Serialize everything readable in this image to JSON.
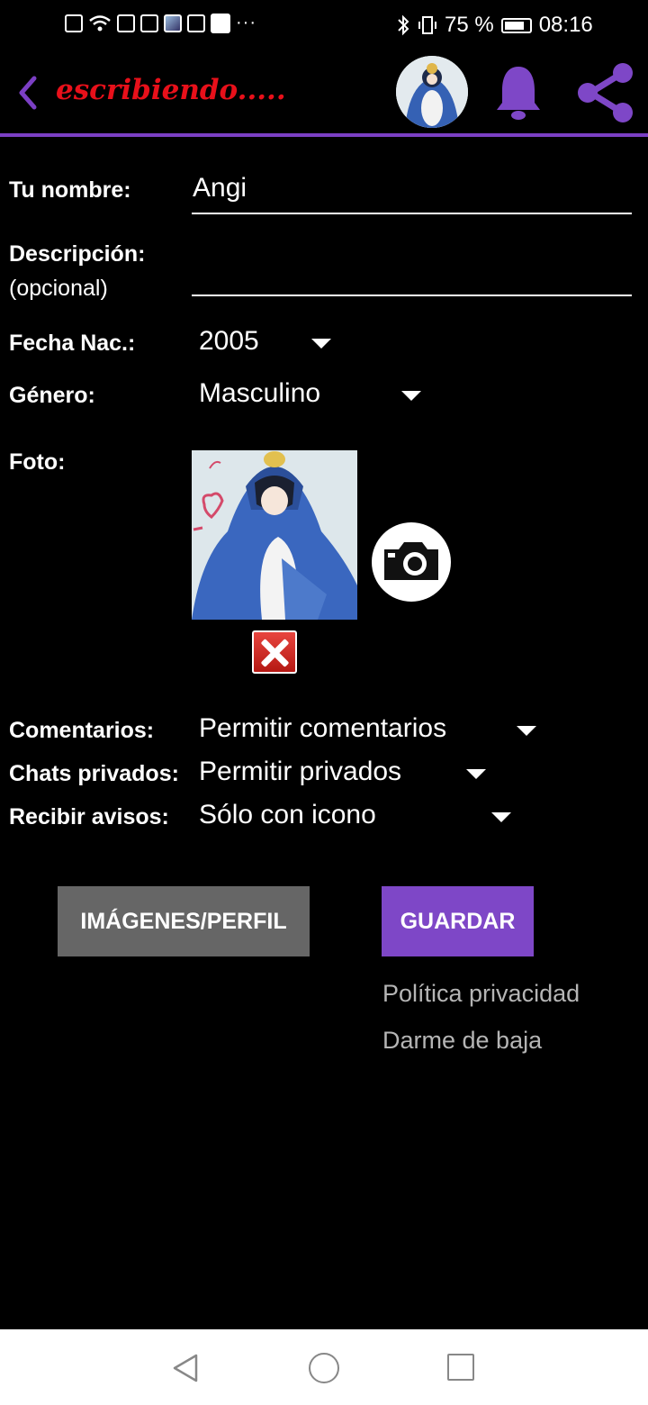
{
  "status_bar": {
    "battery_text": "75 %",
    "time": "08:16",
    "dots": "···"
  },
  "header": {
    "title": "escribiendo.....",
    "accent_color": "#7b3fc4",
    "title_color": "#e8101a"
  },
  "form": {
    "name": {
      "label": "Tu nombre:",
      "value": "Angi"
    },
    "description": {
      "label": "Descripción:",
      "sublabel": "(opcional)",
      "value": ""
    },
    "birth_year": {
      "label": "Fecha Nac.:",
      "value": "2005"
    },
    "gender": {
      "label": "Género:",
      "value": "Masculino"
    },
    "photo": {
      "label": "Foto:"
    },
    "comments": {
      "label": "Comentarios:",
      "value": "Permitir comentarios"
    },
    "private_chats": {
      "label": "Chats privados:",
      "value": "Permitir privados"
    },
    "notifications": {
      "label": "Recibir avisos:",
      "value": "Sólo con icono"
    }
  },
  "buttons": {
    "images_profile": "IMÁGENES/PERFIL",
    "save": "GUARDAR"
  },
  "links": {
    "privacy": "Política privacidad",
    "unsubscribe": "Darme de baja"
  },
  "icons": [
    "back-icon",
    "bell-icon",
    "share-icon",
    "camera-icon",
    "delete-icon",
    "nav-back-icon",
    "nav-home-icon",
    "nav-recent-icon"
  ]
}
